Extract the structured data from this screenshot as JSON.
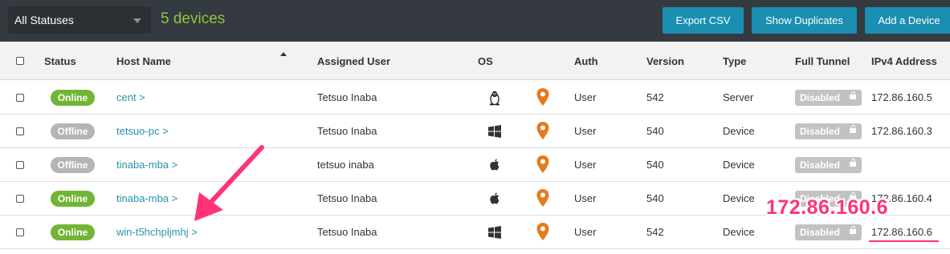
{
  "toolbar": {
    "status_filter": "All Statuses",
    "device_count": "5 devices",
    "export_label": "Export CSV",
    "duplicates_label": "Show Duplicates",
    "add_label": "Add a Device"
  },
  "columns": {
    "status": "Status",
    "host": "Host Name",
    "user": "Assigned User",
    "os": "OS",
    "auth": "Auth",
    "version": "Version",
    "type": "Type",
    "tunnel": "Full Tunnel",
    "ipv4": "IPv4 Address"
  },
  "rows": [
    {
      "status": "Online",
      "host": "cent >",
      "user": "Tetsuo Inaba",
      "os": "linux-icon",
      "auth": "User",
      "version": "542",
      "type": "Server",
      "tunnel": "Disabled",
      "ipv4": "172.86.160.5"
    },
    {
      "status": "Offline",
      "host": "tetsuo-pc >",
      "user": "Tetsuo Inaba",
      "os": "windows-icon",
      "auth": "User",
      "version": "540",
      "type": "Device",
      "tunnel": "Disabled",
      "ipv4": "172.86.160.3"
    },
    {
      "status": "Offline",
      "host": "tinaba-mba >",
      "user": "tetsuo inaba",
      "os": "apple-icon",
      "auth": "User",
      "version": "540",
      "type": "Device",
      "tunnel": "Disabled",
      "ipv4": ""
    },
    {
      "status": "Online",
      "host": "tinaba-mba >",
      "user": "Tetsuo Inaba",
      "os": "apple-icon",
      "auth": "User",
      "version": "540",
      "type": "Device",
      "tunnel": "Disabled",
      "ipv4": "172.86.160.4"
    },
    {
      "status": "Online",
      "host": "win-t5hchpljmhj >",
      "user": "Tetsuo Inaba",
      "os": "windows-icon",
      "auth": "User",
      "version": "542",
      "type": "Device",
      "tunnel": "Disabled",
      "ipv4": "172.86.160.6"
    }
  ],
  "annotation": {
    "callout": "172.86.160.6",
    "color": "#ff3378"
  },
  "colors": {
    "online": "#71b534",
    "offline": "#b5b5b5",
    "link": "#2a90ad",
    "accent": "#1a8fb2",
    "pin": "#e57a1f"
  }
}
